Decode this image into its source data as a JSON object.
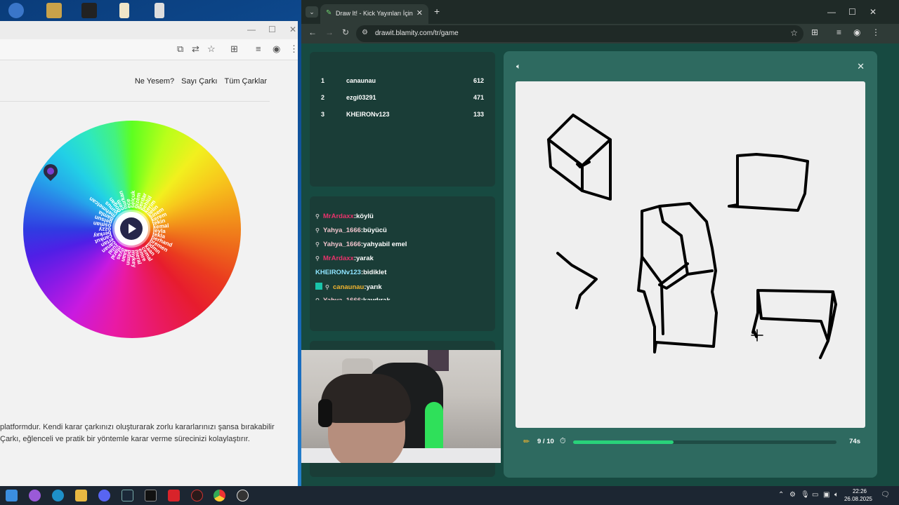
{
  "left_window": {
    "nav": [
      "Ne Yesem?",
      "Sayı Çarkı",
      "Tüm Çarklar"
    ],
    "wheel_labels": [
      "serdar",
      "behlül",
      "kerim",
      "pelin",
      "sinem",
      "kerem",
      "tekin",
      "kemal",
      "leyla",
      "tekla",
      "berhand",
      "bremen",
      "pdmn",
      "kaan",
      "cemal",
      "emre",
      "meral",
      "mykey",
      "pdmn",
      "kaan",
      "ilyas",
      "maral",
      "zülal",
      "canan",
      "ertan",
      "cankut",
      "berkay",
      "ozzy",
      "osman",
      "pelsun",
      "damla",
      "mehmetcan",
      "yunus",
      "dogan",
      "cem",
      "nurkan",
      "ece",
      "selçuk",
      "gizem"
    ],
    "desc_line1": "platformdur. Kendi karar çarkınızı oluşturarak zorlu kararlarınızı şansa bırakabilir",
    "desc_line2": "Çarkı, eğlenceli ve pratik bir yöntemle karar verme sürecinizi kolaylaştırır."
  },
  "right_window": {
    "tab_title": "Draw It! - Kick Yayınları İçin Çizim",
    "url": "drawit.blamity.com/tr/game"
  },
  "leaderboard": [
    {
      "rank": "1",
      "name": "canaunau",
      "score": "612"
    },
    {
      "rank": "2",
      "name": "ezgi03291",
      "score": "471"
    },
    {
      "rank": "3",
      "name": "KHEIRONv123",
      "score": "133"
    }
  ],
  "chat": [
    {
      "user": "MrArdaxx",
      "msg": ":köylü",
      "color": "#e8336b",
      "badge": "pin"
    },
    {
      "user": "Yahya_1666",
      "msg": ":büyücü",
      "color": "#f0c4cc",
      "badge": "pin"
    },
    {
      "user": "Yahya_1666",
      "msg": ":yahyabil emel",
      "color": "#f0c4cc",
      "badge": "pin"
    },
    {
      "user": "MrArdaxx",
      "msg": ":yarak",
      "color": "#e8336b",
      "badge": "pin"
    },
    {
      "user": "KHEIRONv123",
      "msg": ":bidiklet",
      "color": "#8fe4ff",
      "badge": "none"
    },
    {
      "user": "canaunau",
      "msg": ":yarık",
      "color": "#f0b330",
      "badge": "box"
    },
    {
      "user": "Yahya_1666",
      "msg": ":kavdırak",
      "color": "#f0c4cc",
      "badge": "pin"
    }
  ],
  "game": {
    "round": "9 / 10",
    "time_left": "74s",
    "progress": 0.38
  },
  "taskbar": {
    "time": "22:26",
    "date": "26.08.2025"
  },
  "colors": {
    "accent_green": "#29d27a",
    "page_bg": "#174a41",
    "panel_bg": "#1a3d37"
  }
}
